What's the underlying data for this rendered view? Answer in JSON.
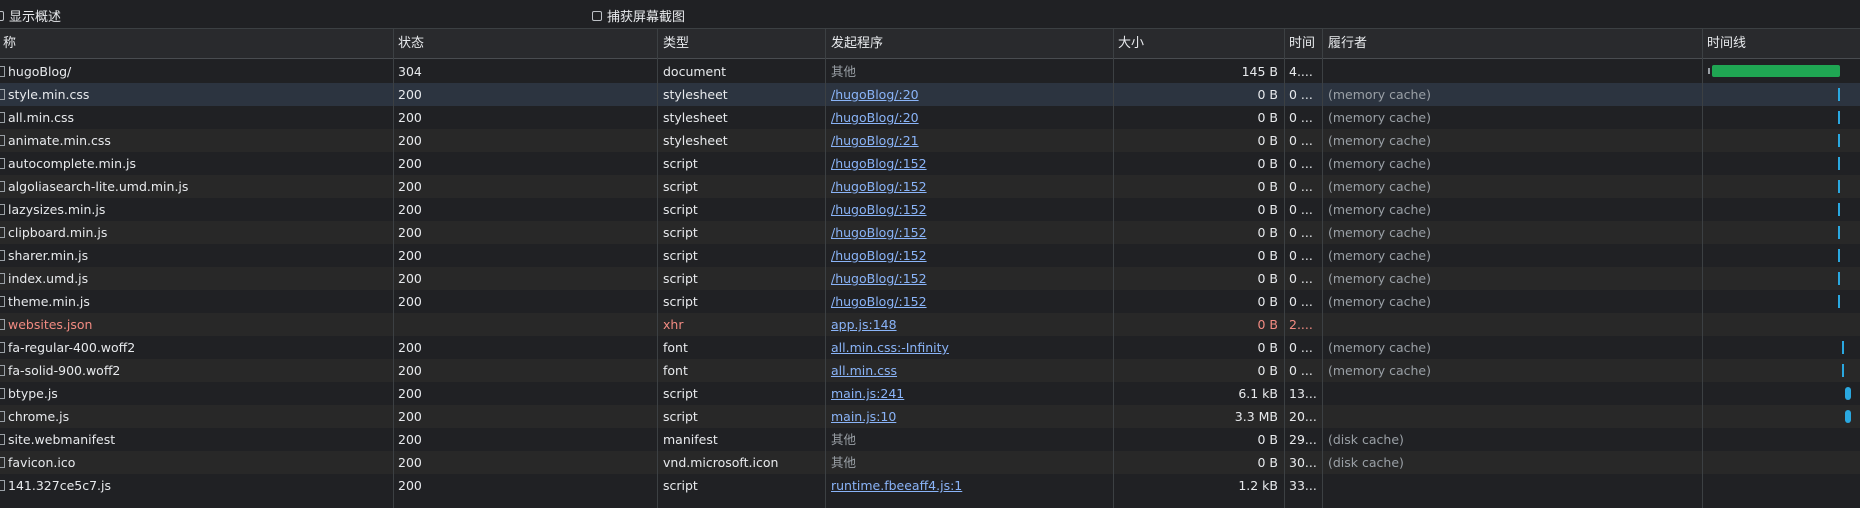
{
  "toolbar": {
    "show_overview": "显示概述",
    "capture_screenshots": "捕获屏幕截图"
  },
  "columns": {
    "name": "称",
    "status": "状态",
    "type": "类型",
    "initiator": "发起程序",
    "size": "大小",
    "time": "时间",
    "fulfilled_by": "履行者",
    "waterfall": "时间线"
  },
  "colors": {
    "accent_green": "#1fa653",
    "accent_blue": "#2aa8e0",
    "link": "#8ab4f8",
    "error": "#f28b82"
  },
  "rows": [
    {
      "name": "hugoBlog/",
      "status": "304",
      "type": "document",
      "initiator": "其他",
      "initiator_link": false,
      "size": "145 B",
      "time": "4....",
      "fulfilled": "",
      "error": false
    },
    {
      "name": "style.min.css",
      "status": "200",
      "type": "stylesheet",
      "initiator": "/hugoBlog/:20",
      "initiator_link": true,
      "size": "0 B",
      "time": "0 ...",
      "fulfilled": "(memory cache)",
      "error": false
    },
    {
      "name": "all.min.css",
      "status": "200",
      "type": "stylesheet",
      "initiator": "/hugoBlog/:20",
      "initiator_link": true,
      "size": "0 B",
      "time": "0 ...",
      "fulfilled": "(memory cache)",
      "error": false
    },
    {
      "name": "animate.min.css",
      "status": "200",
      "type": "stylesheet",
      "initiator": "/hugoBlog/:21",
      "initiator_link": true,
      "size": "0 B",
      "time": "0 ...",
      "fulfilled": "(memory cache)",
      "error": false
    },
    {
      "name": "autocomplete.min.js",
      "status": "200",
      "type": "script",
      "initiator": "/hugoBlog/:152",
      "initiator_link": true,
      "size": "0 B",
      "time": "0 ...",
      "fulfilled": "(memory cache)",
      "error": false
    },
    {
      "name": "algoliasearch-lite.umd.min.js",
      "status": "200",
      "type": "script",
      "initiator": "/hugoBlog/:152",
      "initiator_link": true,
      "size": "0 B",
      "time": "0 ...",
      "fulfilled": "(memory cache)",
      "error": false
    },
    {
      "name": "lazysizes.min.js",
      "status": "200",
      "type": "script",
      "initiator": "/hugoBlog/:152",
      "initiator_link": true,
      "size": "0 B",
      "time": "0 ...",
      "fulfilled": "(memory cache)",
      "error": false
    },
    {
      "name": "clipboard.min.js",
      "status": "200",
      "type": "script",
      "initiator": "/hugoBlog/:152",
      "initiator_link": true,
      "size": "0 B",
      "time": "0 ...",
      "fulfilled": "(memory cache)",
      "error": false
    },
    {
      "name": "sharer.min.js",
      "status": "200",
      "type": "script",
      "initiator": "/hugoBlog/:152",
      "initiator_link": true,
      "size": "0 B",
      "time": "0 ...",
      "fulfilled": "(memory cache)",
      "error": false
    },
    {
      "name": "index.umd.js",
      "status": "200",
      "type": "script",
      "initiator": "/hugoBlog/:152",
      "initiator_link": true,
      "size": "0 B",
      "time": "0 ...",
      "fulfilled": "(memory cache)",
      "error": false
    },
    {
      "name": "theme.min.js",
      "status": "200",
      "type": "script",
      "initiator": "/hugoBlog/:152",
      "initiator_link": true,
      "size": "0 B",
      "time": "0 ...",
      "fulfilled": "(memory cache)",
      "error": false
    },
    {
      "name": "websites.json",
      "status": "",
      "type": "xhr",
      "initiator": "app.js:148",
      "initiator_link": true,
      "size": "0 B",
      "time": "2....",
      "fulfilled": "",
      "error": true
    },
    {
      "name": "fa-regular-400.woff2",
      "status": "200",
      "type": "font",
      "initiator": "all.min.css:-Infinity",
      "initiator_link": true,
      "size": "0 B",
      "time": "0 ...",
      "fulfilled": "(memory cache)",
      "error": false
    },
    {
      "name": "fa-solid-900.woff2",
      "status": "200",
      "type": "font",
      "initiator": "all.min.css",
      "initiator_link": true,
      "size": "0 B",
      "time": "0 ...",
      "fulfilled": "(memory cache)",
      "error": false
    },
    {
      "name": "btype.js",
      "status": "200",
      "type": "script",
      "initiator": "main.js:241",
      "initiator_link": true,
      "size": "6.1 kB",
      "time": "13...",
      "fulfilled": "",
      "error": false
    },
    {
      "name": "chrome.js",
      "status": "200",
      "type": "script",
      "initiator": "main.js:10",
      "initiator_link": true,
      "size": "3.3 MB",
      "time": "20...",
      "fulfilled": "",
      "error": false
    },
    {
      "name": "site.webmanifest",
      "status": "200",
      "type": "manifest",
      "initiator": "其他",
      "initiator_link": false,
      "size": "0 B",
      "time": "29...",
      "fulfilled": "(disk cache)",
      "error": false
    },
    {
      "name": "favicon.ico",
      "status": "200",
      "type": "vnd.microsoft.icon",
      "initiator": "其他",
      "initiator_link": false,
      "size": "0 B",
      "time": "30...",
      "fulfilled": "(disk cache)",
      "error": false
    },
    {
      "name": "141.327ce5c7.js",
      "status": "200",
      "type": "script",
      "initiator": "runtime.fbeeaff4.js:1",
      "initiator_link": true,
      "size": "1.2 kB",
      "time": "33...",
      "fulfilled": "",
      "error": false
    }
  ]
}
